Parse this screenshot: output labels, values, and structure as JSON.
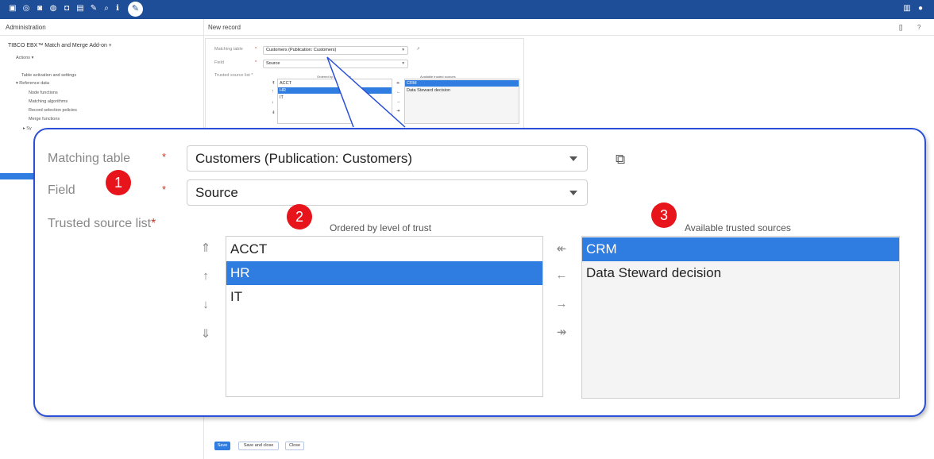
{
  "topbar": {
    "icons": [
      "data-model-icon",
      "workflow-icon",
      "dataspace-icon",
      "perspective-icon",
      "dataset-icon",
      "services-icon",
      "pin-icon",
      "search-icon",
      "admin-tools-icon"
    ],
    "right_icons": [
      "menu-icon",
      "user-icon"
    ],
    "color": "#1f4e99"
  },
  "left": {
    "title": "Administration",
    "addon": "TIBCO EBX™ Match and Merge Add-on",
    "actions": "Actions ▾",
    "items": [
      "Table activation and settings",
      "▾ Reference data",
      "Node functions",
      "Matching algorithms",
      "Record selection policies",
      "Merge functions",
      "▸ Sy"
    ]
  },
  "main": {
    "title": "New record",
    "hdr_controls": [
      "[]",
      "?"
    ]
  },
  "small_form": {
    "matching_table_label": "Matching table",
    "matching_table_value": "Customers (Publication: Customers)",
    "field_label": "Field",
    "field_value": "Source",
    "trusted_label": "Trusted source list *",
    "ordered_head": "Ordered by level of trust",
    "available_head": "Available trusted sources",
    "ordered": [
      "ACCT",
      "HR",
      "IT"
    ],
    "available": [
      "CRM",
      "Data Steward decision"
    ]
  },
  "zoom": {
    "matching_table_label": "Matching table",
    "field_label": "Field",
    "trusted_label": "Trusted source list",
    "required_mark": "*",
    "matching_table_value": "Customers (Publication: Customers)",
    "field_value": "Source",
    "ordered_head": "Ordered by level of trust",
    "available_head": "Available trusted sources",
    "ordered": [
      "ACCT",
      "HR",
      "IT"
    ],
    "available": [
      "CRM",
      "Data Steward decision"
    ],
    "order_arrows": [
      "⇑",
      "↑",
      "↓",
      "⇓"
    ],
    "move_arrows": [
      "↞",
      "←",
      "→",
      "↠"
    ],
    "badges": [
      "1",
      "2",
      "3"
    ]
  },
  "buttons": {
    "save": "Save",
    "save_close": "Save and close",
    "close": "Close"
  },
  "colors": {
    "accent": "#2f7de1",
    "callout_border": "#2b4fd6",
    "badge": "#e8141c"
  }
}
